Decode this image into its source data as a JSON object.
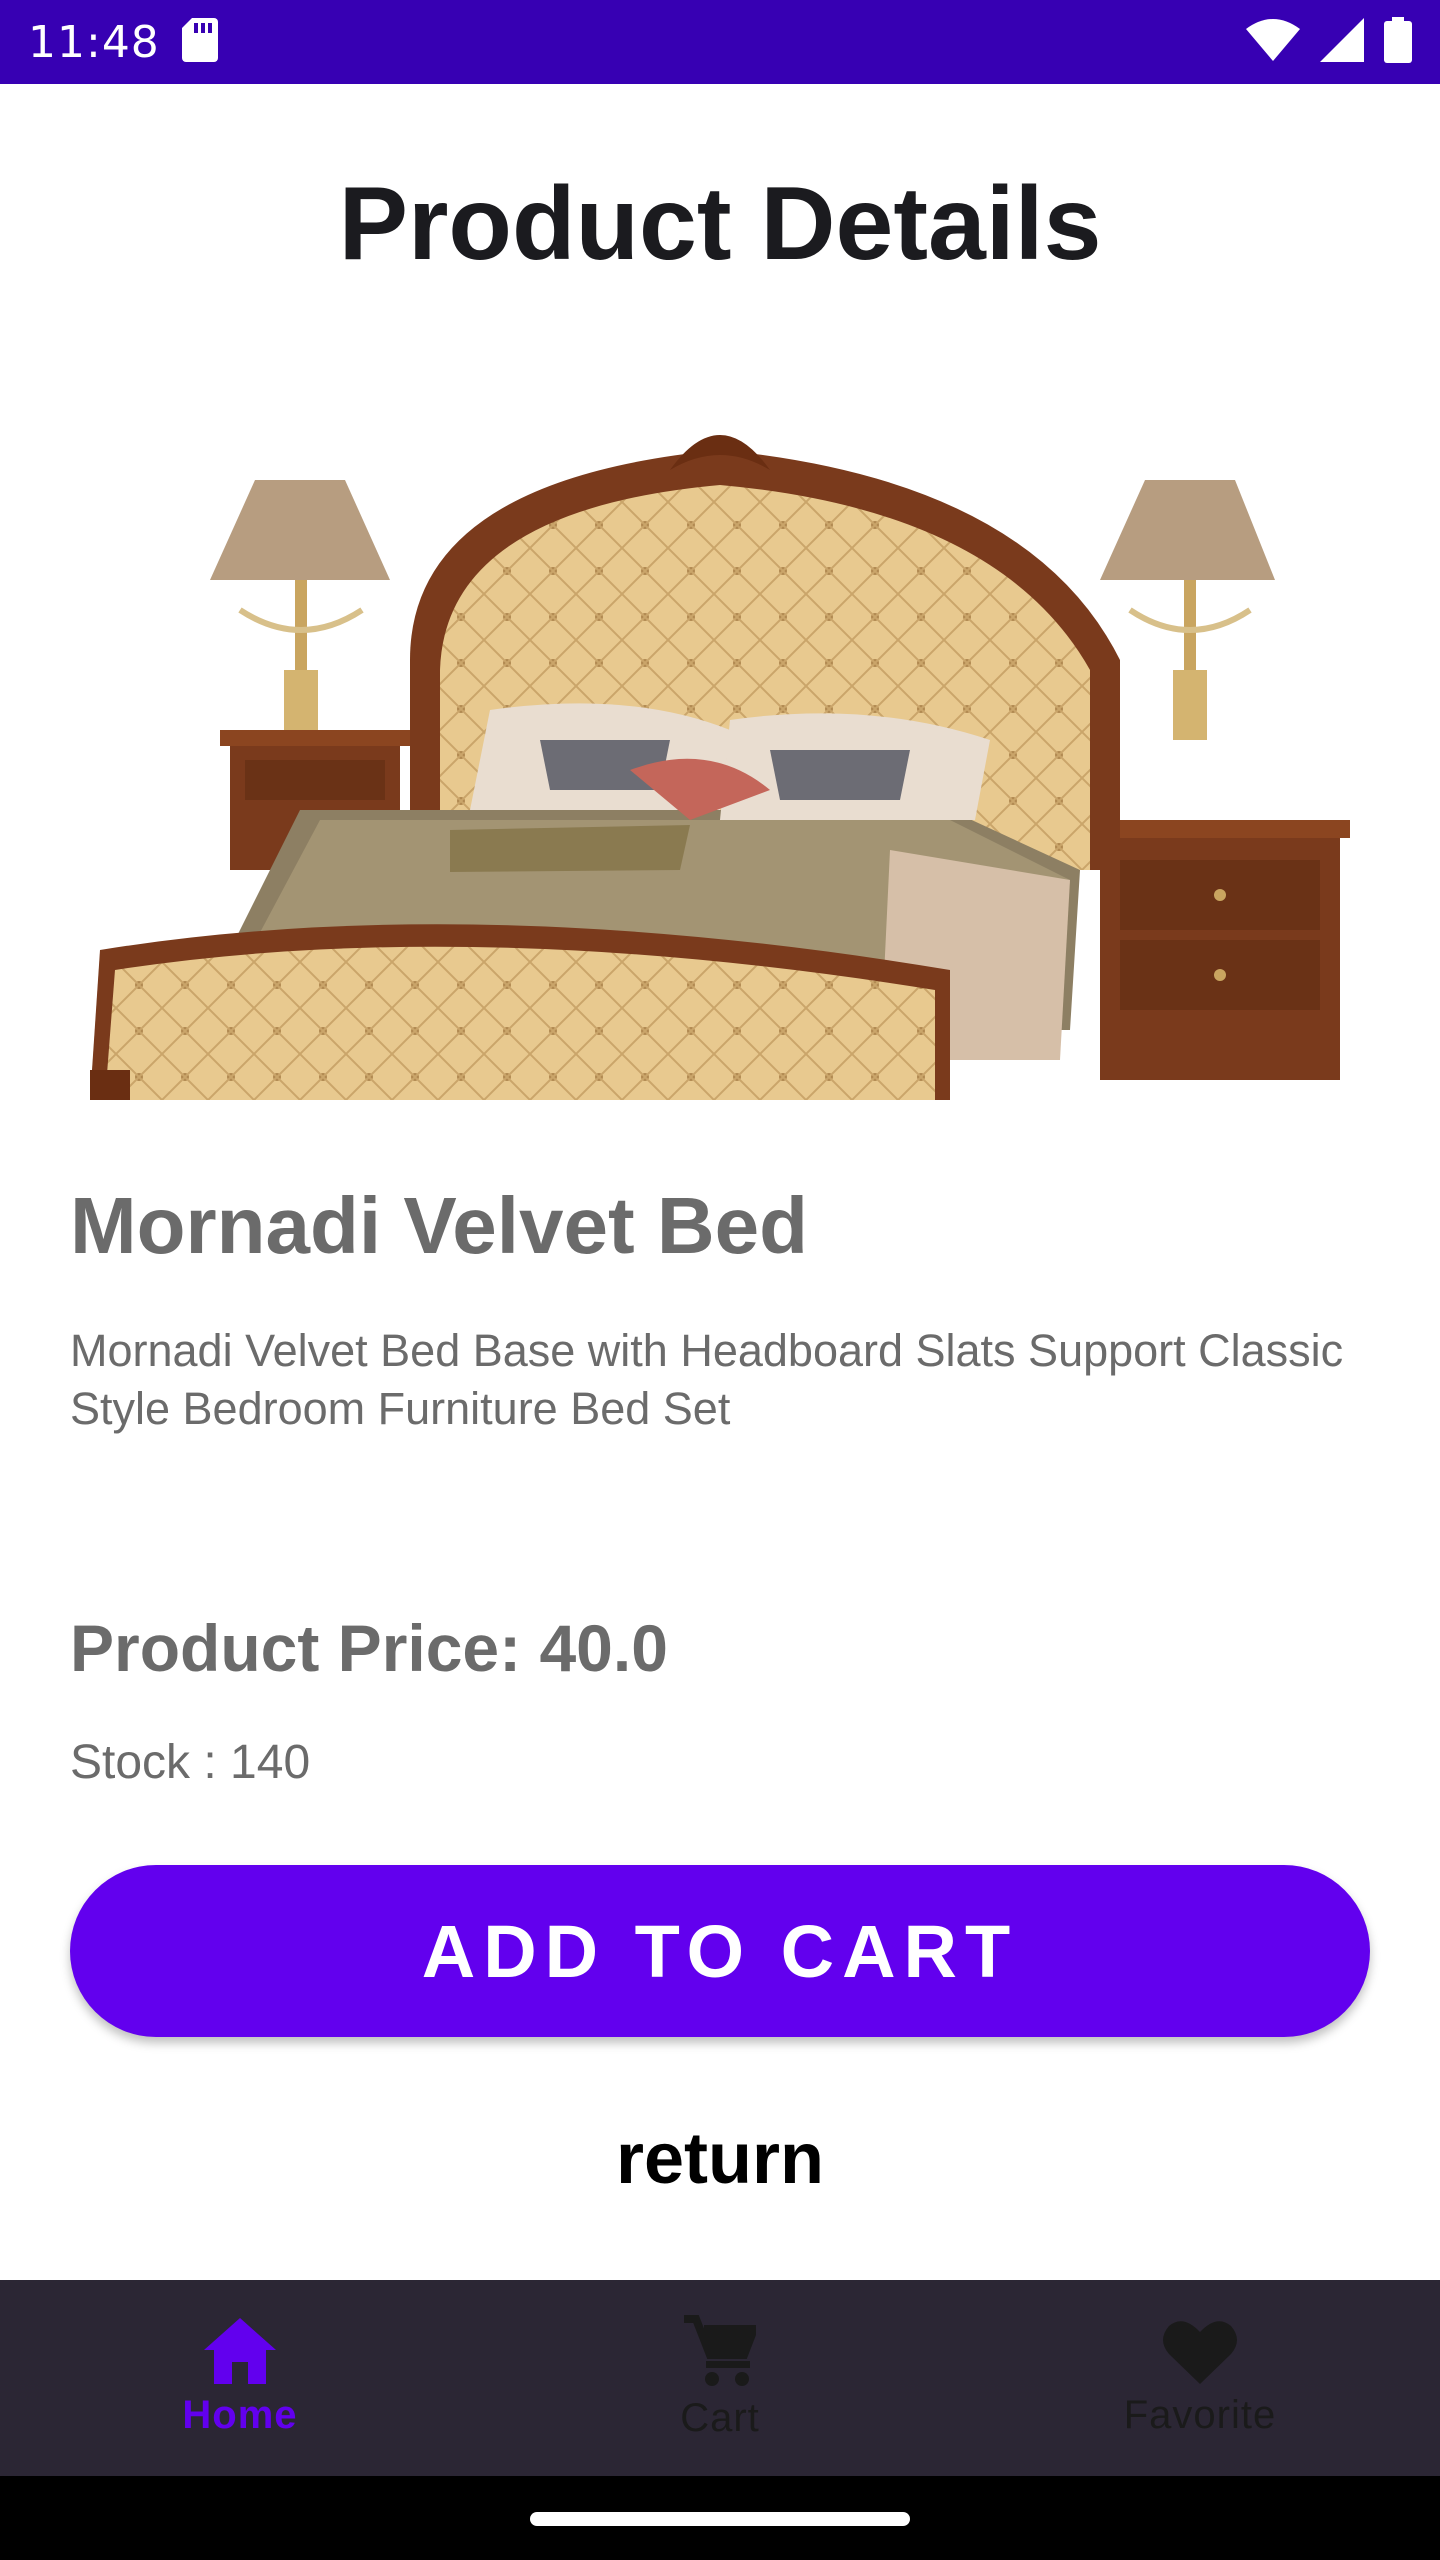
{
  "status_bar": {
    "time": "11:48",
    "icons": [
      "sd-card-icon",
      "wifi-icon",
      "signal-icon",
      "battery-icon"
    ]
  },
  "header": {
    "title": "Product Details"
  },
  "product": {
    "image_subject": "ornate tufted bed with nightstands and lamps",
    "name": "Mornadi Velvet Bed",
    "description": "Mornadi Velvet Bed Base with Headboard Slats Support Classic Style Bedroom Furniture Bed Set",
    "price_label": "Product Price: 40.0",
    "stock_label": "Stock : 140"
  },
  "actions": {
    "add_to_cart": "ADD TO CART",
    "return": "return"
  },
  "bottom_nav": {
    "items": [
      {
        "label": "Home",
        "icon": "home-icon",
        "active": true
      },
      {
        "label": "Cart",
        "icon": "cart-icon",
        "active": false
      },
      {
        "label": "Favorite",
        "icon": "heart-icon",
        "active": false
      }
    ]
  },
  "colors": {
    "status_bar": "#3700b3",
    "primary": "#6200ee",
    "nav_background": "#2b2634",
    "text_secondary": "#6b6b6b"
  }
}
